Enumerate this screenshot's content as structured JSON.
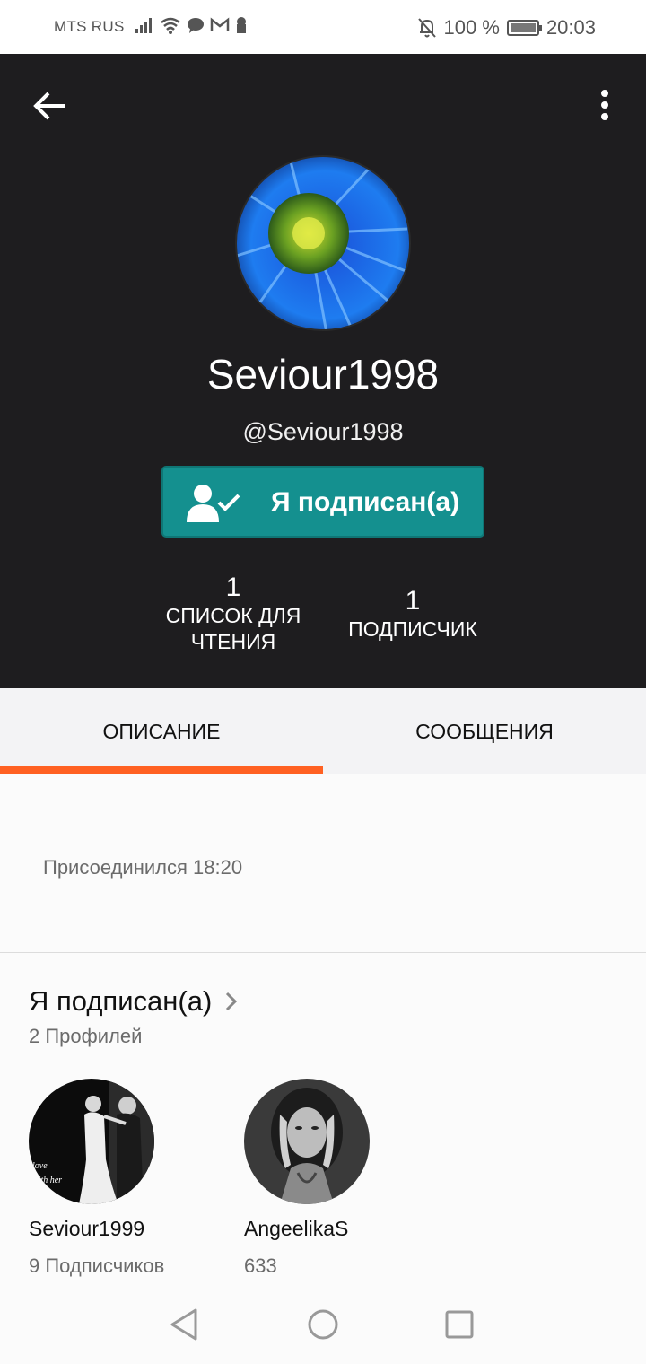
{
  "status_bar": {
    "carrier": "MTS RUS",
    "battery": "100 %",
    "time": "20:03"
  },
  "profile": {
    "display_name": "Seviour1998",
    "username": "@Seviour1998",
    "follow_button_label": "Я подписан(а)",
    "stats": {
      "reading_lists": {
        "value": "1",
        "label": "СПИСОК ДЛЯ ЧТЕНИЯ"
      },
      "followers": {
        "value": "1",
        "label": "ПОДПИСЧИК"
      }
    }
  },
  "tabs": [
    {
      "label": "ОПИСАНИЕ",
      "active": true
    },
    {
      "label": "СООБЩЕНИЯ",
      "active": false
    }
  ],
  "about": {
    "joined": "Присоединился 18:20"
  },
  "following": {
    "title": "Я подписан(а)",
    "count": "2 Профилей",
    "profiles": [
      {
        "name": "Seviour1999",
        "followers": "9 Подписчиков"
      },
      {
        "name": "AngeelikaS",
        "followers": "633"
      }
    ]
  },
  "colors": {
    "header_bg": "#1e1d1f",
    "follow_button": "#14908f",
    "tab_indicator": "#ff6122"
  },
  "icons": [
    "back-arrow-icon",
    "more-vertical-icon",
    "user-check-icon",
    "chevron-right-icon",
    "nav-back-icon",
    "nav-home-icon",
    "nav-recent-icon"
  ]
}
